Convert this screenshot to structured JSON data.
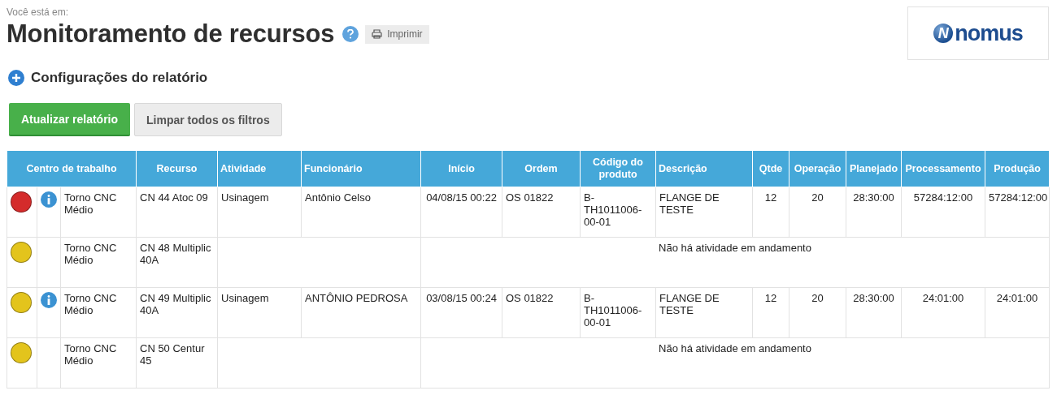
{
  "breadcrumb": "Você está em:",
  "title": "Monitoramento de recursos",
  "print_button": "Imprimir",
  "logo": {
    "mark": "N",
    "text": "nomus"
  },
  "config": {
    "label": "Configurações do relatório",
    "expanded": false
  },
  "buttons": {
    "primary": "Atualizar relatório",
    "secondary": "Limpar todos os filtros"
  },
  "table": {
    "columns": [
      "Centro de trabalho",
      "Recurso",
      "Atividade",
      "Funcionário",
      "Início",
      "Ordem",
      "Código do produto",
      "Descrição",
      "Qtde",
      "Operação",
      "Planejado",
      "Processamento",
      "Produção"
    ],
    "rows": [
      {
        "kind": "activity",
        "color": "#d42b2b",
        "info": true,
        "centro": "Torno CNC Médio",
        "recurso": "CN 44 Atoc 09",
        "atividade": "Usinagem",
        "funcionario": "Antônio Celso",
        "inicio": "04/08/15 00:22",
        "ordem": "OS 01822",
        "codigo": "B-TH1011006-00-01",
        "descricao": "FLANGE DE TESTE",
        "qtde": "12",
        "operacao": "20",
        "planejado": "28:30:00",
        "processamento": "57284:12:00",
        "producao": "57284:12:00"
      },
      {
        "kind": "idle",
        "color": "#e3c41c",
        "info": false,
        "centro": "Torno CNC Médio",
        "recurso": "CN 48 Multiplic 40A",
        "message": "Não há atividade em andamento"
      },
      {
        "kind": "activity",
        "color": "#e3c41c",
        "info": true,
        "centro": "Torno CNC Médio",
        "recurso": "CN 49 Multiplic 40A",
        "atividade": "Usinagem",
        "funcionario": "ANTÔNIO PEDROSA",
        "inicio": "03/08/15 00:24",
        "ordem": "OS 01822",
        "codigo": "B-TH1011006-00-01",
        "descricao": "FLANGE DE TESTE",
        "qtde": "12",
        "operacao": "20",
        "planejado": "28:30:00",
        "processamento": "24:01:00",
        "producao": "24:01:00"
      },
      {
        "kind": "idle",
        "color": "#e3c41c",
        "info": false,
        "centro": "Torno CNC Médio",
        "recurso": "CN 50 Centur 45",
        "message": "Não há atividade em andamento"
      }
    ]
  }
}
